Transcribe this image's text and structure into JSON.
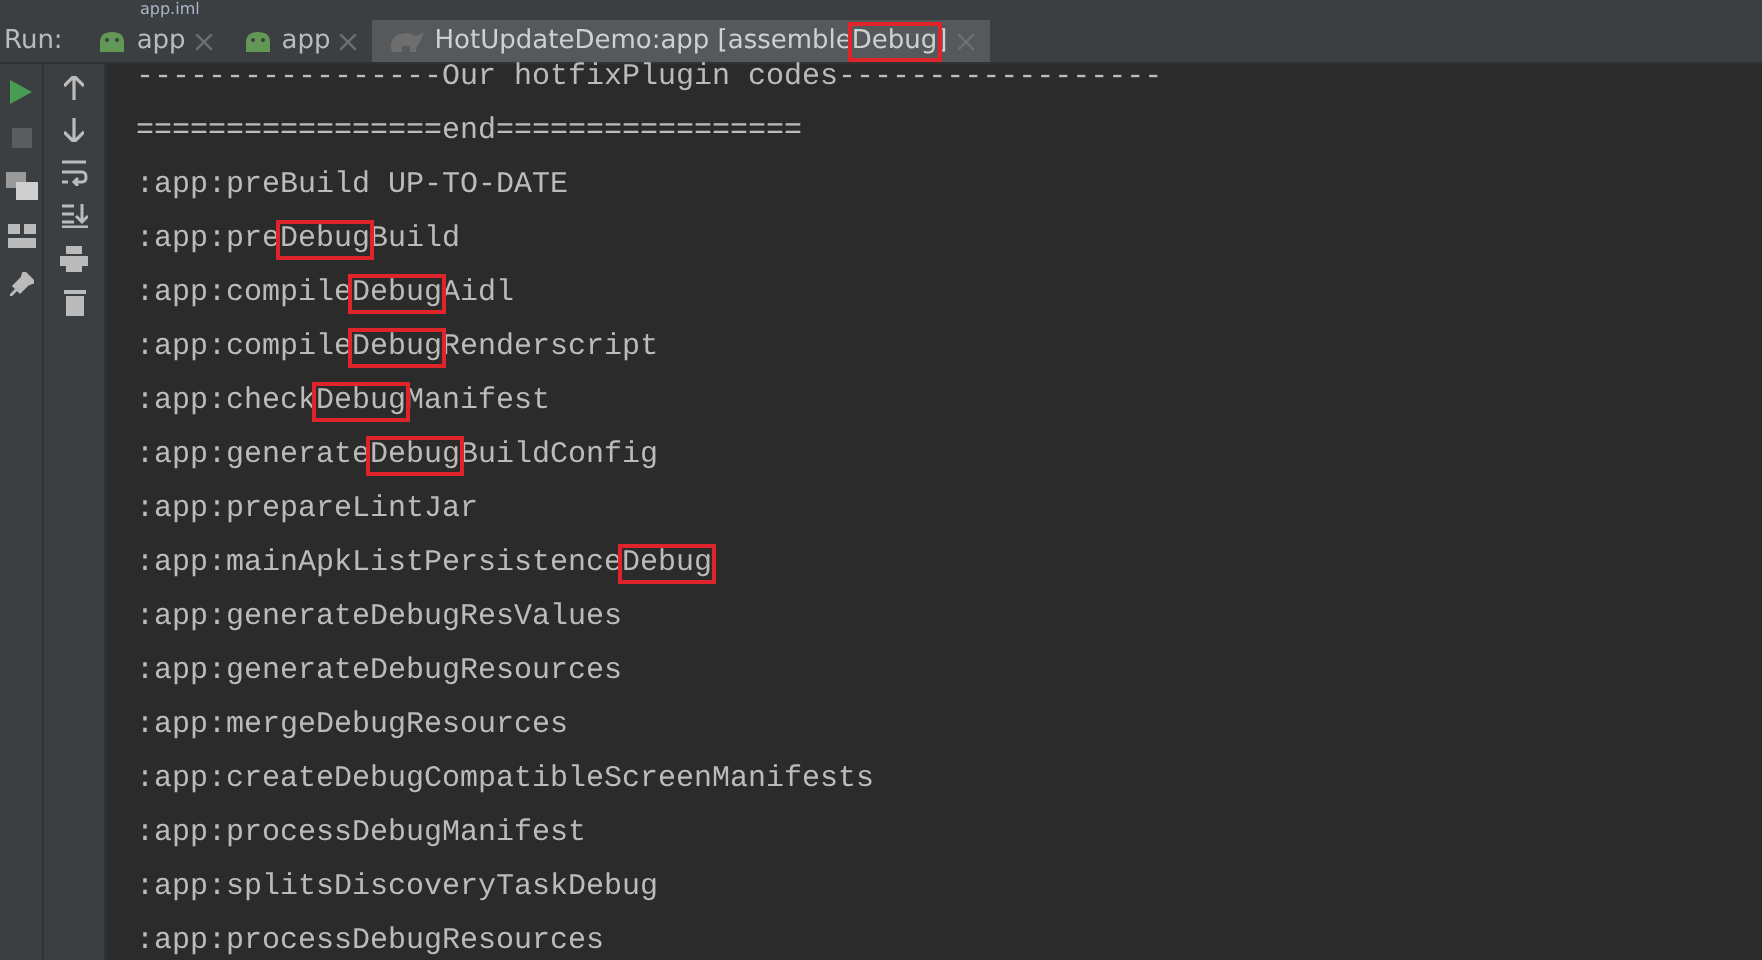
{
  "file_tab": {
    "label": "app.iml"
  },
  "run_panel": {
    "label": "Run:",
    "tabs": [
      {
        "kind": "android",
        "segments": [
          {
            "text": "app",
            "highlighted": false
          }
        ],
        "selected": false
      },
      {
        "kind": "android",
        "segments": [
          {
            "text": "app",
            "highlighted": false
          }
        ],
        "selected": false
      },
      {
        "kind": "gradle",
        "segments": [
          {
            "text": "HotUpdateDemo:app [assemble",
            "highlighted": false
          },
          {
            "text": "Debug",
            "highlighted": true
          },
          {
            "text": "]",
            "highlighted": false
          }
        ],
        "selected": true
      }
    ]
  },
  "console": {
    "lines": [
      [
        {
          "text": "-----------------Our hotfixPlugin codes------------------",
          "highlighted": false
        }
      ],
      [
        {
          "text": "=================end=================",
          "highlighted": false
        }
      ],
      [
        {
          "text": ":app:preBuild UP-TO-DATE",
          "highlighted": false
        }
      ],
      [
        {
          "text": ":app:pre",
          "highlighted": false
        },
        {
          "text": "Debug",
          "highlighted": true
        },
        {
          "text": "Build",
          "highlighted": false
        }
      ],
      [
        {
          "text": ":app:compile",
          "highlighted": false
        },
        {
          "text": "Debug",
          "highlighted": true
        },
        {
          "text": "Aidl",
          "highlighted": false
        }
      ],
      [
        {
          "text": ":app:compile",
          "highlighted": false
        },
        {
          "text": "Debug",
          "highlighted": true
        },
        {
          "text": "Renderscript",
          "highlighted": false
        }
      ],
      [
        {
          "text": ":app:check",
          "highlighted": false
        },
        {
          "text": "Debug",
          "highlighted": true
        },
        {
          "text": "Manifest",
          "highlighted": false
        }
      ],
      [
        {
          "text": ":app:generate",
          "highlighted": false
        },
        {
          "text": "Debug",
          "highlighted": true
        },
        {
          "text": "BuildConfig",
          "highlighted": false
        }
      ],
      [
        {
          "text": ":app:prepareLintJar",
          "highlighted": false
        }
      ],
      [
        {
          "text": ":app:mainApkListPersistence",
          "highlighted": false
        },
        {
          "text": "Debug",
          "highlighted": true
        }
      ],
      [
        {
          "text": ":app:generateDebugResValues",
          "highlighted": false
        }
      ],
      [
        {
          "text": ":app:generateDebugResources",
          "highlighted": false
        }
      ],
      [
        {
          "text": ":app:mergeDebugResources",
          "highlighted": false
        }
      ],
      [
        {
          "text": ":app:createDebugCompatibleScreenManifests",
          "highlighted": false
        }
      ],
      [
        {
          "text": ":app:processDebugManifest",
          "highlighted": false
        }
      ],
      [
        {
          "text": ":app:splitsDiscoveryTaskDebug",
          "highlighted": false
        }
      ],
      [
        {
          "text": ":app:processDebugResources",
          "highlighted": false
        }
      ]
    ]
  }
}
